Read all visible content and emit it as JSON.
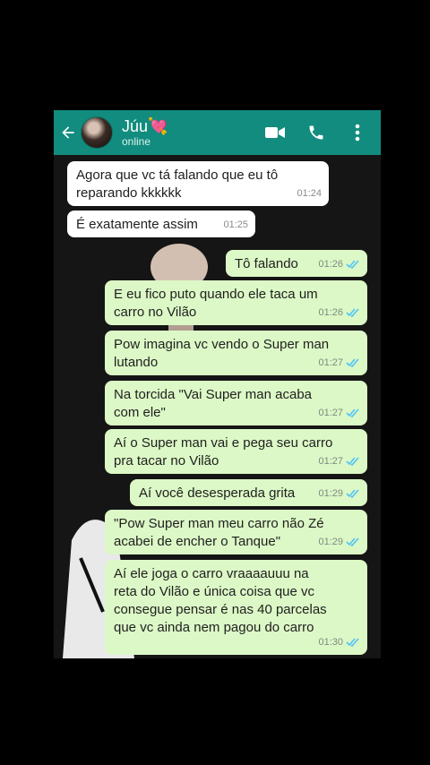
{
  "header": {
    "contact_name": "Júu💘",
    "status": "online",
    "colors": {
      "bar": "#128c7e"
    }
  },
  "icons": {
    "back": "arrow-left-icon",
    "video": "video-camera-icon",
    "call": "phone-icon",
    "menu": "more-vertical-icon"
  },
  "messages": [
    {
      "dir": "in",
      "text": "Agora que vc tá falando que eu tô\nreparando kkkkkk",
      "time": "01:24"
    },
    {
      "dir": "in",
      "text": "É exatamente assim",
      "time": "01:25"
    },
    {
      "dir": "out",
      "text": "Tô falando",
      "time": "01:26",
      "read": true
    },
    {
      "dir": "out",
      "text": "E eu fico puto quando ele taca um\ncarro no Vilão",
      "time": "01:26",
      "read": true
    },
    {
      "dir": "out",
      "text": "Pow imagina vc vendo o Super man\nlutando",
      "time": "01:27",
      "read": true
    },
    {
      "dir": "out",
      "text": "Na torcida \"Vai Super man acaba\ncom ele\"",
      "time": "01:27",
      "read": true
    },
    {
      "dir": "out",
      "text": "Aí o Super man vai e pega seu carro\npra tacar no Vilão",
      "time": "01:27",
      "read": true
    },
    {
      "dir": "out",
      "text": "Aí você desesperada grita",
      "time": "01:29",
      "read": true
    },
    {
      "dir": "out",
      "text": "\"Pow Super man meu carro não Zé\nacabei de encher o Tanque\"",
      "time": "01:29",
      "read": true
    },
    {
      "dir": "out",
      "text": "Aí ele joga o carro vraaaauuu na\nreta do Vilão e única coisa que vc\nconsegue pensar é nas 40 parcelas\nque vc ainda nem pagou do carro",
      "time": "01:30",
      "read": true
    }
  ],
  "colors": {
    "incoming": "#ffffff",
    "outgoing": "#dcf8c6",
    "read_ticks": "#4fc3f7"
  }
}
